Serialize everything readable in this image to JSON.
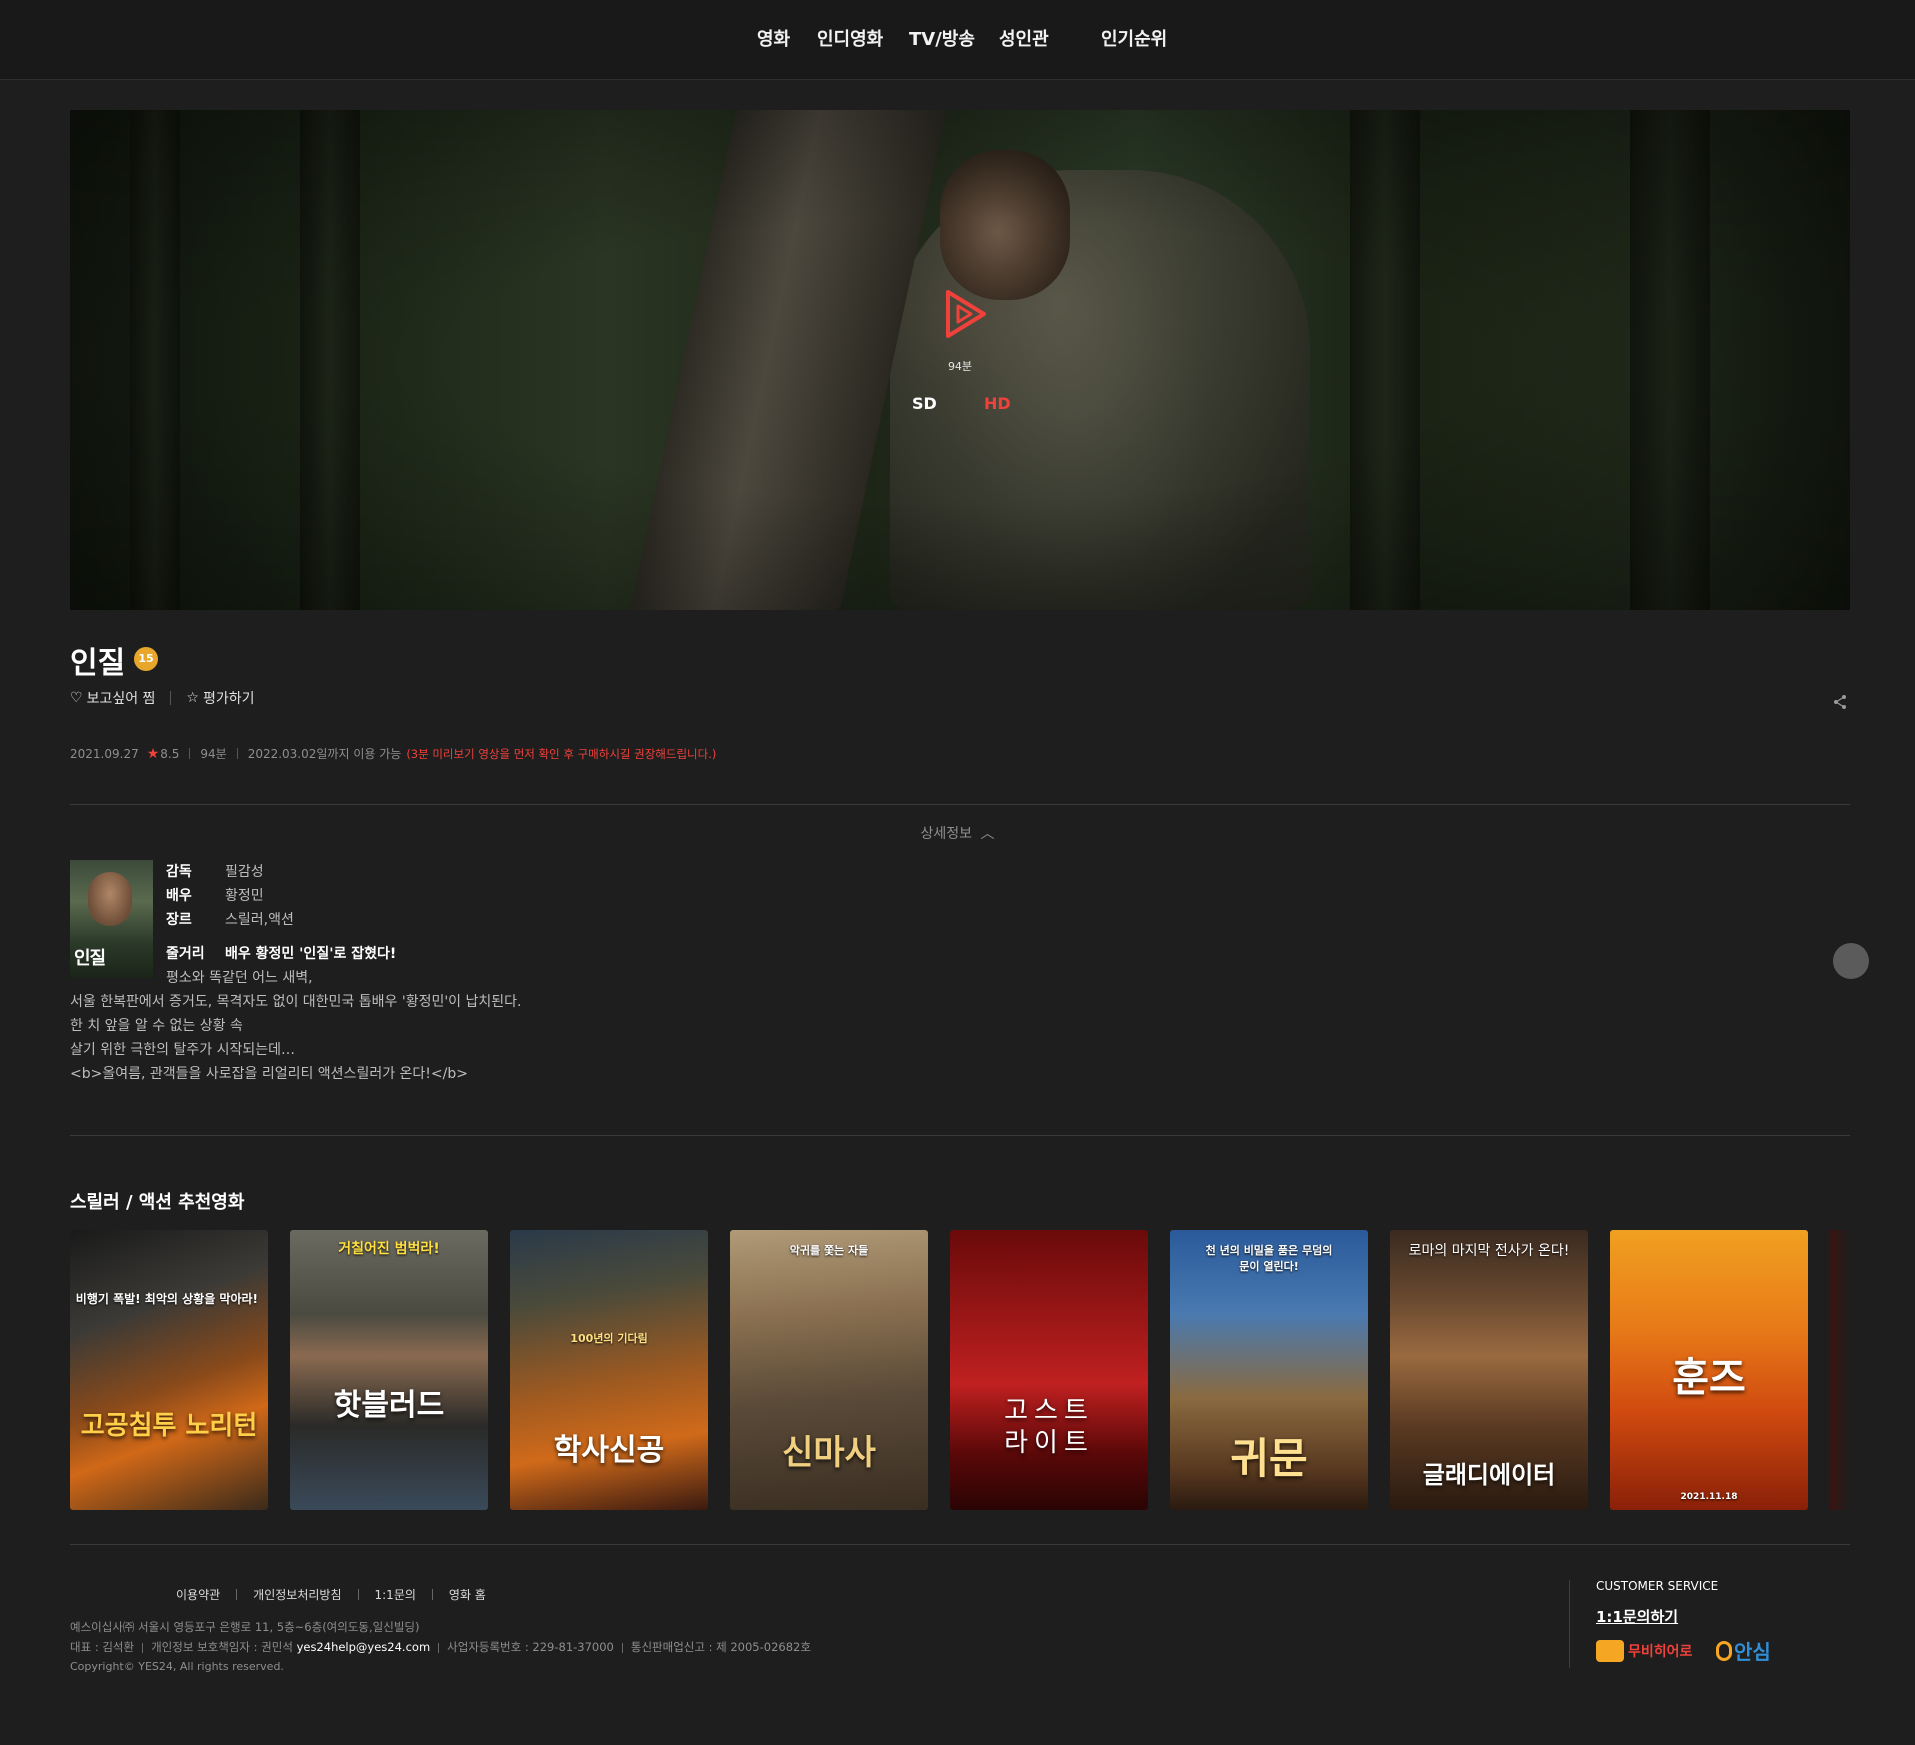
{
  "nav": {
    "items": [
      "영화",
      "인디영화",
      "TV/방송",
      "성인관",
      "인기순위"
    ]
  },
  "hero": {
    "runtime": "94분",
    "quality_sd": "SD",
    "quality_hd": "HD"
  },
  "movie": {
    "title": "인질",
    "age_rating": "15",
    "wish_label": "보고싶어 찜",
    "rate_label": "평가하기",
    "release_date": "2021.09.27",
    "score": "8.5",
    "duration": "94분",
    "available_until": "2022.03.02일까지 이용 가능",
    "notice": "(3분 미리보기 영상을 먼저 확인 후 구매하시길 권장해드립니다.)"
  },
  "detail": {
    "toggle_label": "상세정보",
    "thumb_text": "인질",
    "rows": [
      {
        "key": "감독",
        "value": "필감성"
      },
      {
        "key": "배우",
        "value": "황정민"
      },
      {
        "key": "장르",
        "value": "스릴러,액션"
      }
    ],
    "plot_key": "줄거리",
    "plot_head": "배우 황정민 '인질'로 잡혔다!",
    "plot_lines": [
      "평소와 똑같던 어느 새벽,",
      "서울 한복판에서 증거도, 목격자도 없이 대한민국 톱배우 '황정민'이 납치된다.",
      "한 치 앞을 알 수 없는 상황 속",
      "살기 위한 극한의 탈주가 시작되는데…",
      "<b>올여름, 관객들을 사로잡을 리얼리티 액션스릴러가 온다!</b>"
    ]
  },
  "recommend": {
    "title": "스릴러 / 액션 추천영화",
    "posters": [
      {
        "title": "고공침투 노리턴",
        "tagline": "비행기 폭발! 최악의 상황을 막아라!"
      },
      {
        "title": "핫블러드",
        "tagline": "거칠어진 범벅라!"
      },
      {
        "title": "학사신공",
        "tagline": "100년의 기다림"
      },
      {
        "title": "신마사",
        "tagline": "악귀를 쫓는 자들"
      },
      {
        "title": "고스트 라이트",
        "tagline": ""
      },
      {
        "title": "귀문",
        "tagline": "천 년의 비밀을 품은 무덤의 문이 열린다!"
      },
      {
        "title": "글래디에이터",
        "tagline": "로마의 마지막 전사가 온다!"
      },
      {
        "title": "훈즈",
        "tagline": "2021.11.18"
      }
    ]
  },
  "footer": {
    "links": [
      "이용약관",
      "개인정보처리방침",
      "1:1문의",
      "영화 홈"
    ],
    "address": "예스이십사㈜ 서울시 영등포구 은행로 11, 5층~6층(여의도동,일신빌딩)",
    "ceo": "대표 : 김석환",
    "privacy_officer": "개인정보 보호책임자 : 권민석",
    "email": "yes24help@yes24.com",
    "business_no": "사업자등록번호 : 229-81-37000",
    "ecommerce_no": "통신판매업신고 : 제 2005-02682호",
    "copyright": "Copyright© YES24, All rights reserved.",
    "cs_title": "CUSTOMER SERVICE",
    "cs_link": "1:1문의하기",
    "logo_hero": "무비히어로",
    "logo_ansim": "안심"
  },
  "colors": {
    "accent_red": "#f0413b",
    "badge_orange": "#e8a62b",
    "background": "#1e1e1e"
  }
}
